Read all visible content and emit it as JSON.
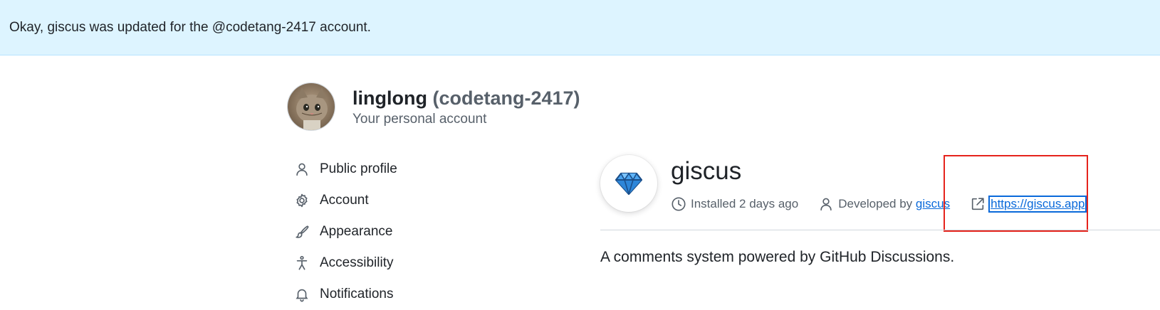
{
  "flash": {
    "message": "Okay, giscus was updated for the @codetang-2417 account."
  },
  "account": {
    "display_name": "linglong",
    "login": "(codetang-2417)",
    "subtitle": "Your personal account"
  },
  "nav": {
    "items": [
      {
        "label": "Public profile",
        "icon": "person-icon"
      },
      {
        "label": "Account",
        "icon": "gear-icon"
      },
      {
        "label": "Appearance",
        "icon": "paintbrush-icon"
      },
      {
        "label": "Accessibility",
        "icon": "accessibility-icon"
      },
      {
        "label": "Notifications",
        "icon": "bell-icon"
      }
    ]
  },
  "app": {
    "name": "giscus",
    "installed": "Installed 2 days ago",
    "developed_prefix": "Developed by",
    "developer": "giscus",
    "website": "https://giscus.app",
    "description": "A comments system powered by GitHub Discussions.",
    "logo_icon": "diamond-icon"
  },
  "colors": {
    "flash_bg": "#ddf4ff",
    "link": "#0969da",
    "highlight": "#e5231c"
  }
}
